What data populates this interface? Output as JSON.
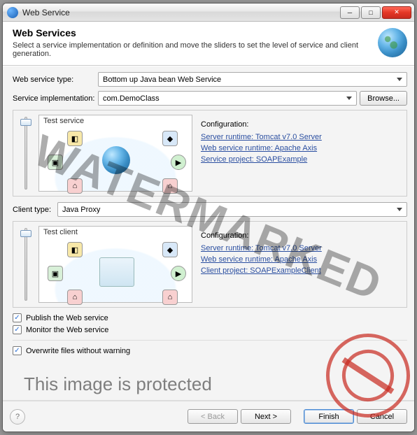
{
  "window": {
    "title": "Web Service"
  },
  "header": {
    "heading": "Web Services",
    "subtext": "Select a service implementation or definition and move the sliders to set the level of service and client generation."
  },
  "fields": {
    "web_service_type_label": "Web service type:",
    "web_service_type_value": "Bottom up Java bean Web Service",
    "service_impl_label": "Service implementation:",
    "service_impl_value": "com.DemoClass",
    "browse_btn": "Browse...",
    "client_type_label": "Client type:",
    "client_type_value": "Java Proxy"
  },
  "service_panel": {
    "title": "Test service",
    "config_label": "Configuration:",
    "links": {
      "server_runtime": "Server runtime: Tomcat v7.0 Server",
      "ws_runtime": "Web service runtime: Apache Axis",
      "project": "Service project: SOAPExample"
    }
  },
  "client_panel": {
    "title": "Test client",
    "config_label": "Configuration:",
    "links": {
      "server_runtime": "Server runtime: Tomcat v7.0 Server",
      "ws_runtime": "Web service runtime: Apache Axis",
      "project": "Client project: SOAPExampleClient"
    }
  },
  "checks": {
    "publish": "Publish the Web service",
    "monitor": "Monitor the Web service",
    "overwrite": "Overwrite files without warning"
  },
  "footer": {
    "back": "< Back",
    "next": "Next >",
    "finish": "Finish",
    "cancel": "Cancel"
  },
  "watermark": {
    "main": "WATERMARKED",
    "protected": "This image is protected"
  }
}
